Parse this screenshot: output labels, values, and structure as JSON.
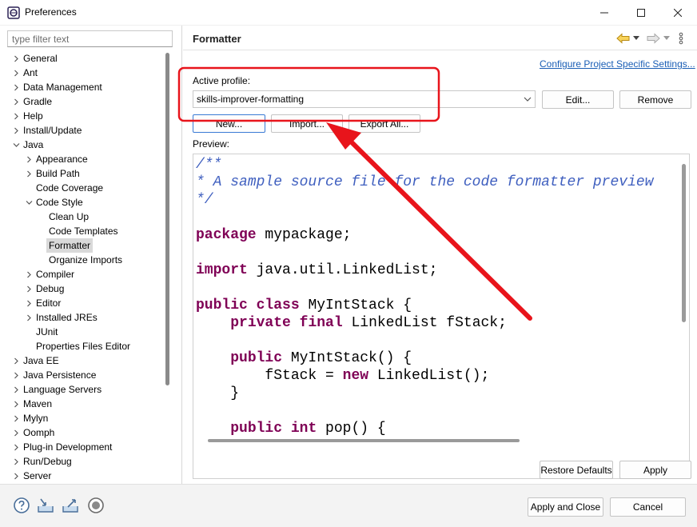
{
  "window": {
    "title": "Preferences",
    "controls": {
      "minimize_icon": "minimize-icon",
      "maximize_icon": "maximize-icon",
      "close_icon": "close-icon"
    }
  },
  "sidebar": {
    "filter_placeholder": "type filter text",
    "tree": [
      {
        "label": "General",
        "level": 0,
        "expander": "collapsed"
      },
      {
        "label": "Ant",
        "level": 0,
        "expander": "collapsed"
      },
      {
        "label": "Data Management",
        "level": 0,
        "expander": "collapsed"
      },
      {
        "label": "Gradle",
        "level": 0,
        "expander": "collapsed"
      },
      {
        "label": "Help",
        "level": 0,
        "expander": "collapsed"
      },
      {
        "label": "Install/Update",
        "level": 0,
        "expander": "collapsed"
      },
      {
        "label": "Java",
        "level": 0,
        "expander": "expanded"
      },
      {
        "label": "Appearance",
        "level": 1,
        "expander": "collapsed"
      },
      {
        "label": "Build Path",
        "level": 1,
        "expander": "collapsed"
      },
      {
        "label": "Code Coverage",
        "level": 1,
        "expander": "none"
      },
      {
        "label": "Code Style",
        "level": 1,
        "expander": "expanded"
      },
      {
        "label": "Clean Up",
        "level": 2,
        "expander": "none"
      },
      {
        "label": "Code Templates",
        "level": 2,
        "expander": "none"
      },
      {
        "label": "Formatter",
        "level": 2,
        "expander": "none",
        "selected": true
      },
      {
        "label": "Organize Imports",
        "level": 2,
        "expander": "none"
      },
      {
        "label": "Compiler",
        "level": 1,
        "expander": "collapsed"
      },
      {
        "label": "Debug",
        "level": 1,
        "expander": "collapsed"
      },
      {
        "label": "Editor",
        "level": 1,
        "expander": "collapsed"
      },
      {
        "label": "Installed JREs",
        "level": 1,
        "expander": "collapsed"
      },
      {
        "label": "JUnit",
        "level": 1,
        "expander": "none"
      },
      {
        "label": "Properties Files Editor",
        "level": 1,
        "expander": "none"
      },
      {
        "label": "Java EE",
        "level": 0,
        "expander": "collapsed"
      },
      {
        "label": "Java Persistence",
        "level": 0,
        "expander": "collapsed"
      },
      {
        "label": "Language Servers",
        "level": 0,
        "expander": "collapsed"
      },
      {
        "label": "Maven",
        "level": 0,
        "expander": "collapsed"
      },
      {
        "label": "Mylyn",
        "level": 0,
        "expander": "collapsed"
      },
      {
        "label": "Oomph",
        "level": 0,
        "expander": "collapsed"
      },
      {
        "label": "Plug-in Development",
        "level": 0,
        "expander": "collapsed"
      },
      {
        "label": "Run/Debug",
        "level": 0,
        "expander": "collapsed"
      },
      {
        "label": "Server",
        "level": 0,
        "expander": "collapsed"
      }
    ]
  },
  "main": {
    "title": "Formatter",
    "configure_link": "Configure Project Specific Settings...",
    "active_profile_label": "Active profile:",
    "active_profile_value": "skills-improver-formatting",
    "buttons": {
      "edit": "Edit...",
      "remove": "Remove",
      "new": "New...",
      "import": "Import...",
      "export_all": "Export All..."
    },
    "preview_label": "Preview:",
    "preview_code": [
      [
        {
          "t": "/**",
          "c": "cm"
        }
      ],
      [
        {
          "t": "* A sample source file for the code formatter preview",
          "c": "cm"
        }
      ],
      [
        {
          "t": "*/",
          "c": "cm"
        }
      ],
      [],
      [
        {
          "t": "package",
          "c": "kw"
        },
        {
          "t": " mypackage;",
          "c": ""
        }
      ],
      [],
      [
        {
          "t": "import",
          "c": "kw"
        },
        {
          "t": " java.util.LinkedList;",
          "c": ""
        }
      ],
      [],
      [
        {
          "t": "public",
          "c": "kw"
        },
        {
          "t": " ",
          "c": ""
        },
        {
          "t": "class",
          "c": "kw"
        },
        {
          "t": " MyIntStack {",
          "c": ""
        }
      ],
      [
        {
          "t": "    ",
          "c": ""
        },
        {
          "t": "private",
          "c": "kw"
        },
        {
          "t": " ",
          "c": ""
        },
        {
          "t": "final",
          "c": "kw"
        },
        {
          "t": " LinkedList fStack;",
          "c": ""
        }
      ],
      [],
      [
        {
          "t": "    ",
          "c": ""
        },
        {
          "t": "public",
          "c": "kw"
        },
        {
          "t": " MyIntStack() {",
          "c": ""
        }
      ],
      [
        {
          "t": "        fStack = ",
          "c": ""
        },
        {
          "t": "new",
          "c": "kw"
        },
        {
          "t": " LinkedList();",
          "c": ""
        }
      ],
      [
        {
          "t": "    }",
          "c": ""
        }
      ],
      [],
      [
        {
          "t": "    ",
          "c": ""
        },
        {
          "t": "public",
          "c": "kw"
        },
        {
          "t": " ",
          "c": ""
        },
        {
          "t": "int",
          "c": "kw"
        },
        {
          "t": " pop() {",
          "c": ""
        }
      ]
    ],
    "restore_defaults": "Restore Defaults",
    "apply": "Apply"
  },
  "footer": {
    "apply_and_close": "Apply and Close",
    "cancel": "Cancel",
    "icons": [
      "help-icon",
      "import-preferences-icon",
      "export-preferences-icon",
      "record-icon"
    ]
  },
  "colors": {
    "annotation": "#e8141b",
    "keyword": "#7f0055",
    "comment": "#3f5fbf",
    "link": "#1a5eb5",
    "selection": "#d9d9d9"
  }
}
